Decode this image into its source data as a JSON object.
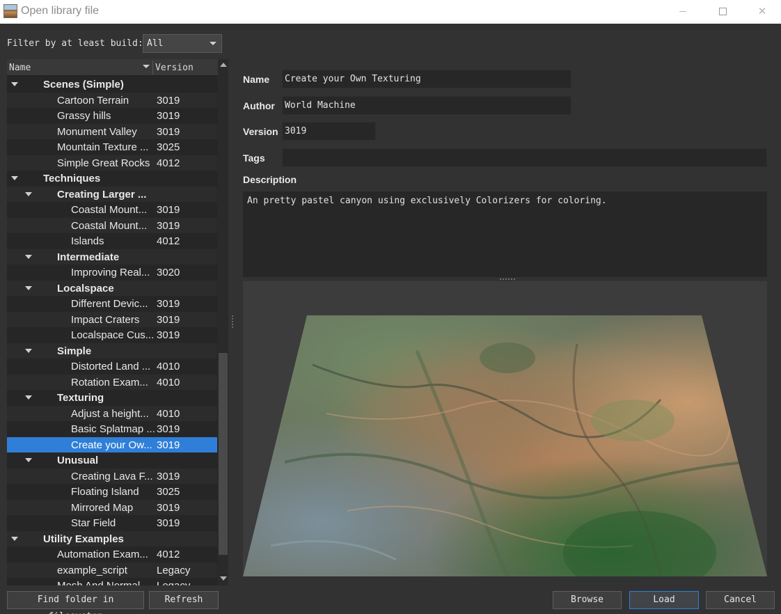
{
  "window": {
    "title": "Open library file",
    "min_icon": "minimize-icon",
    "max_icon": "maximize-icon",
    "close_symbol": "✕"
  },
  "filter": {
    "label": "Filter by at least build:",
    "selected": "All"
  },
  "tree": {
    "columns": {
      "name": "Name",
      "version": "Version"
    },
    "rows": [
      {
        "label": "Scenes (Simple)",
        "version": "",
        "level": 0,
        "group": true
      },
      {
        "label": "Cartoon Terrain",
        "version": "3019",
        "level": 1,
        "group": false
      },
      {
        "label": "Grassy hills",
        "version": "3019",
        "level": 1,
        "group": false
      },
      {
        "label": "Monument Valley",
        "version": "3019",
        "level": 1,
        "group": false
      },
      {
        "label": "Mountain Texture ...",
        "version": "3025",
        "level": 1,
        "group": false
      },
      {
        "label": "Simple Great Rocks",
        "version": "4012",
        "level": 1,
        "group": false
      },
      {
        "label": "Techniques",
        "version": "",
        "level": 0,
        "group": true
      },
      {
        "label": "Creating Larger ...",
        "version": "",
        "level": 1,
        "group": true
      },
      {
        "label": "Coastal Mount...",
        "version": "3019",
        "level": 2,
        "group": false
      },
      {
        "label": "Coastal Mount...",
        "version": "3019",
        "level": 2,
        "group": false
      },
      {
        "label": "Islands",
        "version": "4012",
        "level": 2,
        "group": false
      },
      {
        "label": "Intermediate",
        "version": "",
        "level": 1,
        "group": true
      },
      {
        "label": "Improving Real...",
        "version": "3020",
        "level": 2,
        "group": false
      },
      {
        "label": "Localspace",
        "version": "",
        "level": 1,
        "group": true
      },
      {
        "label": "Different Devic...",
        "version": "3019",
        "level": 2,
        "group": false
      },
      {
        "label": "Impact Craters",
        "version": "3019",
        "level": 2,
        "group": false
      },
      {
        "label": "Localspace Cus...",
        "version": "3019",
        "level": 2,
        "group": false
      },
      {
        "label": "Simple",
        "version": "",
        "level": 1,
        "group": true
      },
      {
        "label": "Distorted Land ...",
        "version": "4010",
        "level": 2,
        "group": false
      },
      {
        "label": "Rotation Exam...",
        "version": "4010",
        "level": 2,
        "group": false
      },
      {
        "label": "Texturing",
        "version": "",
        "level": 1,
        "group": true
      },
      {
        "label": "Adjust a height...",
        "version": "4010",
        "level": 2,
        "group": false
      },
      {
        "label": "Basic Splatmap ...",
        "version": "3019",
        "level": 2,
        "group": false
      },
      {
        "label": "Create your Ow...",
        "version": "3019",
        "level": 2,
        "group": false,
        "selected": true
      },
      {
        "label": "Unusual",
        "version": "",
        "level": 1,
        "group": true
      },
      {
        "label": "Creating Lava F...",
        "version": "3019",
        "level": 2,
        "group": false
      },
      {
        "label": "Floating Island",
        "version": "3025",
        "level": 2,
        "group": false
      },
      {
        "label": "Mirrored Map",
        "version": "3019",
        "level": 2,
        "group": false
      },
      {
        "label": "Star Field",
        "version": "3019",
        "level": 2,
        "group": false
      },
      {
        "label": "Utility Examples",
        "version": "",
        "level": 0,
        "group": true
      },
      {
        "label": "Automation Exam...",
        "version": "4012",
        "level": 1,
        "group": false
      },
      {
        "label": "example_script",
        "version": "Legacy",
        "level": 1,
        "group": false
      },
      {
        "label": "Mesh And Normal...",
        "version": "Legacy",
        "level": 1,
        "group": false
      }
    ]
  },
  "details": {
    "name_label": "Name",
    "name_value": "Create your Own Texturing",
    "author_label": "Author",
    "author_value": "World Machine",
    "version_label": "Version",
    "version_value": "3019",
    "tags_label": "Tags",
    "tags_value": "",
    "description_label": "Description",
    "description_value": "An pretty pastel canyon using exclusively Colorizers for coloring."
  },
  "buttons": {
    "find_folder": "Find folder in filesystem",
    "refresh": "Refresh",
    "browse": "Browse",
    "load": "Load",
    "cancel": "Cancel"
  },
  "colors": {
    "selection": "#2f7fd8",
    "background": "#323232",
    "panel": "#262626"
  }
}
